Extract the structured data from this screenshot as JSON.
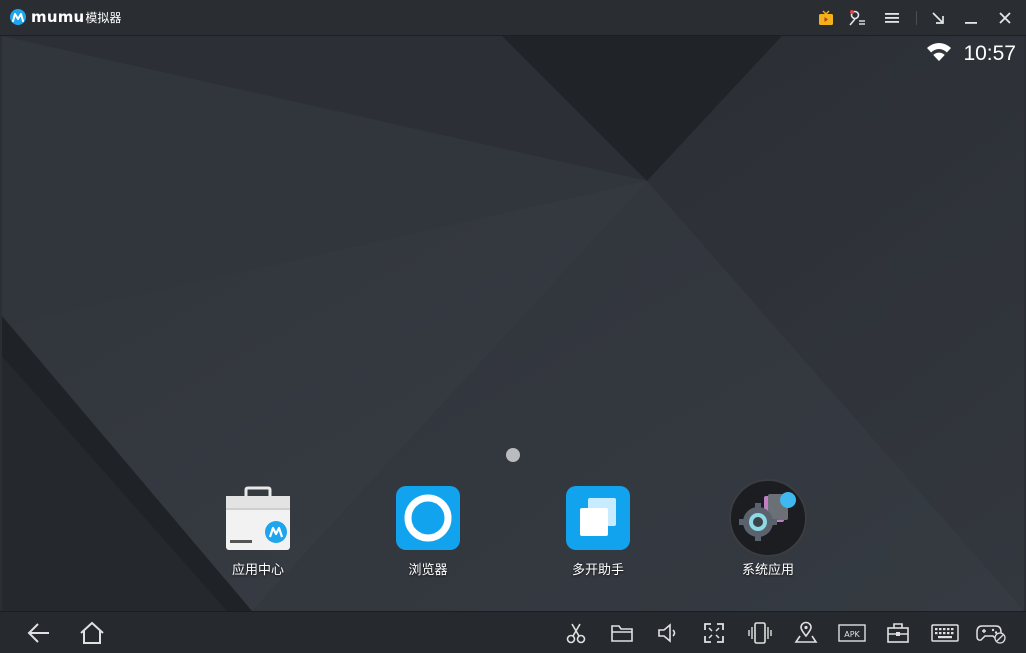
{
  "window": {
    "brand": "mumu",
    "brand_suffix": "模拟器",
    "icons": [
      "tv-icon",
      "account-icon",
      "menu-icon",
      "shrink-icon",
      "minimize-icon",
      "close-icon"
    ]
  },
  "statusbar": {
    "time": "10:57",
    "icons": [
      "wifi-icon"
    ]
  },
  "home": {
    "apps": [
      {
        "label": "应用中心",
        "icon": "app-center-icon"
      },
      {
        "label": "浏览器",
        "icon": "browser-icon"
      },
      {
        "label": "多开助手",
        "icon": "multi-instance-icon"
      },
      {
        "label": "系统应用",
        "icon": "system-apps-icon"
      }
    ]
  },
  "navbar": {
    "left_icons": [
      "back-icon",
      "home-icon"
    ],
    "right_icons": [
      "scissors-icon",
      "folder-icon",
      "volume-icon",
      "fullscreen-icon",
      "shake-icon",
      "location-icon",
      "apk-icon",
      "toolbox-icon",
      "keyboard-icon",
      "gamepad-icon"
    ],
    "apk_text": "APK"
  },
  "colors": {
    "accent": "#1ea5ee",
    "titlebar": "#2a2d32",
    "navbar": "#26292e"
  }
}
